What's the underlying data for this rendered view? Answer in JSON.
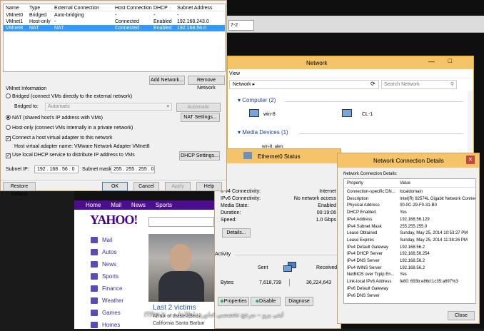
{
  "vnet_editor": {
    "columns": [
      "Name",
      "Type",
      "External Connection",
      "Host Connection",
      "DHCP",
      "Subnet Address"
    ],
    "rows": [
      [
        "VMnet0",
        "Bridged",
        "Auto-bridging",
        "-",
        "-",
        "-"
      ],
      [
        "VMnet1",
        "Host-only",
        "-",
        "Connected",
        "Enabled",
        "192.168.243.0"
      ],
      [
        "VMnet8",
        "NAT",
        "NAT",
        "Connected",
        "Enabled",
        "192.168.56.0"
      ]
    ],
    "add_network": "Add Network...",
    "remove_network": "Remove Network",
    "info_label": "VMnet Information",
    "bridged_label": "Bridged (connect VMs directly to the external network)",
    "bridged_to_label": "Bridged to:",
    "bridged_to_value": "Automatic",
    "auto_settings": "Automatic Settings...",
    "nat_label": "NAT (shared host's IP address with VMs)",
    "nat_settings": "NAT Settings...",
    "hostonly_label": "Host-only (connect VMs internally in a private network)",
    "connect_adapter_label": "Connect a host virtual adapter to this network",
    "adapter_name_label": "Host virtual adapter name: VMware Network Adapter VMnet8",
    "dhcp_label": "Use local DHCP service to distribute IP address to VMs",
    "dhcp_settings": "DHCP Settings...",
    "subnet_ip_label": "Subnet IP:",
    "subnet_ip_value": "192 . 168 . 56 . 0",
    "subnet_mask_label": "Subnet mask:",
    "subnet_mask_value": "255 . 255 . 255 . 0",
    "restore_default": "Restore Default",
    "ok": "OK",
    "cancel": "Cancel",
    "apply": "Apply",
    "help": "Help"
  },
  "vm_tab": {
    "label": "7-2"
  },
  "network_window": {
    "title": "Network",
    "menu_view": "View",
    "address": "Network",
    "search_placeholder": "Search Network",
    "computer_group": "Computer (2)",
    "computers": [
      "win-8",
      "CL-1"
    ],
    "media_group": "Media Devices (1)",
    "media_item": "win-8: alen:"
  },
  "ethernet_status": {
    "title": "Ethernet0 Status",
    "connection_label": "tion",
    "rows": [
      [
        "IPv4 Connectivity:",
        "Internet"
      ],
      [
        "IPv6 Connectivity:",
        "No network access"
      ],
      [
        "Media State:",
        "Enabled"
      ],
      [
        "Duration:",
        "00:19:06"
      ],
      [
        "Speed:",
        "1.0 Gbps"
      ]
    ],
    "details_btn": "Details...",
    "activity_label": "Activity",
    "sent_label": "Sent",
    "received_label": "Received",
    "bytes_label": "Bytes:",
    "bytes_sent": "7,618,739",
    "bytes_received": "36,224,643",
    "properties_btn": "Properties",
    "disable_btn": "Disable",
    "diagnose_btn": "Diagnose"
  },
  "details_dialog": {
    "title": "Network Connection Details",
    "subtitle": "Network Connection Details:",
    "col_property": "Property",
    "col_value": "Value",
    "rows": [
      [
        "Connection-specific DN...",
        "localdomain"
      ],
      [
        "Description",
        "Intel(R) 82574L Gigabit Network Connect"
      ],
      [
        "Physical Address",
        "00-0C-29-F0-31-B0"
      ],
      [
        "DHCP Enabled",
        "Yes"
      ],
      [
        "IPv4 Address",
        "192.168.56.129"
      ],
      [
        "IPv4 Subnet Mask",
        "255.255.255.0"
      ],
      [
        "Lease Obtained",
        "Sunday, May 25, 2014 10:53:27 PM"
      ],
      [
        "Lease Expires",
        "Sunday, May 25, 2014 11:38:26 PM"
      ],
      [
        "IPv4 Default Gateway",
        "192.168.56.2"
      ],
      [
        "IPv4 DHCP Server",
        "192.168.56.254"
      ],
      [
        "IPv4 DNS Server",
        "192.168.56.2"
      ],
      [
        "IPv4 WINS Server",
        "192.168.56.2"
      ],
      [
        "NetBIOS over Tcpip En...",
        "Yes"
      ],
      [
        "Link-local IPv6 Address",
        "fe80::693b:e86d:1c35:a697%3"
      ],
      [
        "IPv6 Default Gateway",
        ""
      ],
      [
        "IPv6 DNS Server",
        ""
      ]
    ],
    "close_btn": "Close"
  },
  "yahoo": {
    "nav": [
      "Home",
      "Mail",
      "News",
      "Sports"
    ],
    "logo": "YAHOO!",
    "menu": [
      "Mail",
      "Autos",
      "News",
      "Sports",
      "Finance",
      "Weather",
      "Games",
      "Homes"
    ],
    "headline": "Last 2 victims",
    "sub1": "All six of these killed i",
    "sub2": "California Santa Barbar"
  },
  "watermark": "ایتی پرو – مرجع تخصصی فناوری اطلاعات – ITPro.ir",
  "colors": {
    "selection": "#3399ff",
    "yahoo_purple": "#400090",
    "yahoo_nav": "#4b0f8e",
    "window_border": "#c9a36b",
    "link_blue": "#1e5aa8"
  }
}
